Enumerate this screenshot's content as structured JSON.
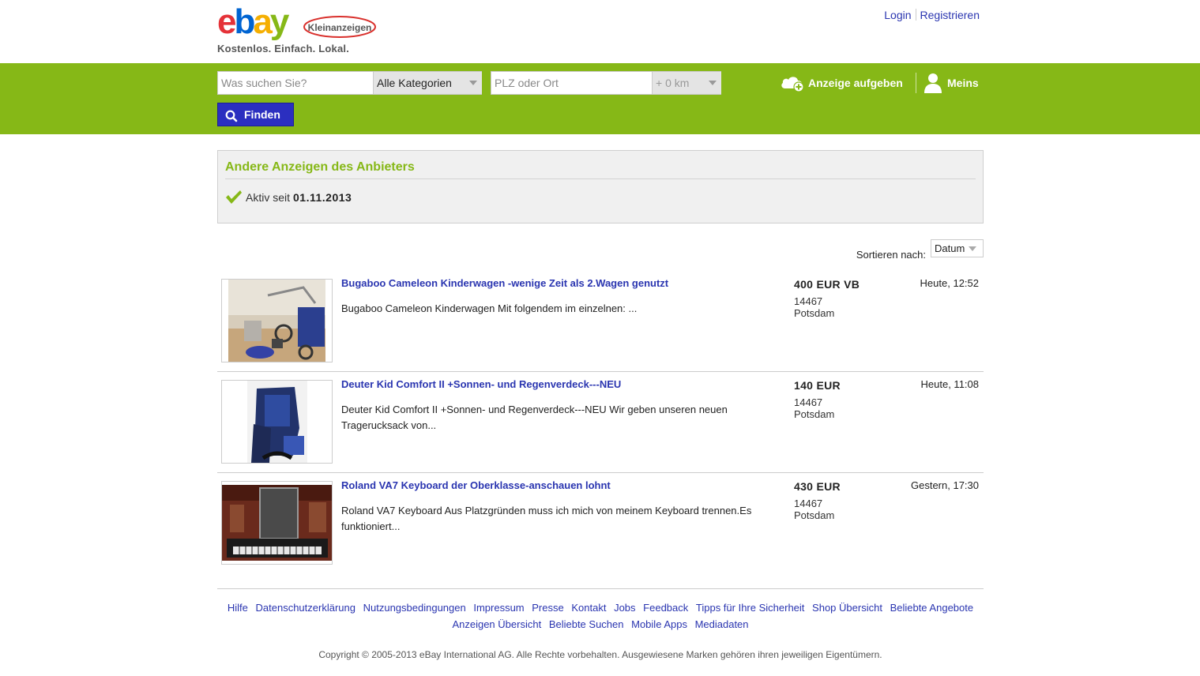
{
  "header": {
    "logo_text": "ebay",
    "logo_badge": "Kleinanzeigen",
    "tagline": "Kostenlos. Einfach. Lokal.",
    "login": "Login",
    "register": "Registrieren"
  },
  "search": {
    "query_placeholder": "Was suchen Sie?",
    "category": "Alle Kategorien",
    "location_placeholder": "PLZ oder Ort",
    "radius": "+ 0 km",
    "find_label": "Finden",
    "post_ad_label": "Anzeige aufgeben",
    "meins_label": "Meins"
  },
  "seller": {
    "title": "Andere Anzeigen des Anbieters",
    "active_prefix": "Aktiv seit",
    "active_date": "01.11.2013"
  },
  "sort": {
    "label": "Sortieren nach:",
    "value": "Datum"
  },
  "listings": [
    {
      "title": "Bugaboo Cameleon Kinderwagen -wenige Zeit als 2.Wagen genutzt",
      "description": "Bugaboo Cameleon Kinderwagen Mit folgendem im einzelnen: ...",
      "price": "400 EUR VB",
      "zip": "14467",
      "city": "Potsdam",
      "date": "Heute, 12:52"
    },
    {
      "title": "Deuter Kid Comfort II +Sonnen- und Regenverdeck---NEU",
      "description": "Deuter Kid Comfort II +Sonnen- und Regenverdeck---NEU Wir geben unseren neuen Tragerucksack von...",
      "price": "140 EUR",
      "zip": "14467",
      "city": "Potsdam",
      "date": "Heute, 11:08"
    },
    {
      "title": "Roland VA7 Keyboard der Oberklasse-anschauen lohnt",
      "description": "Roland VA7 Keyboard Aus Platzgründen muss ich mich von meinem Keyboard trennen.Es funktioniert...",
      "price": "430 EUR",
      "zip": "14467",
      "city": "Potsdam",
      "date": "Gestern, 17:30"
    }
  ],
  "footer": {
    "links": [
      "Hilfe",
      "Datenschutzerklärung",
      "Nutzungsbedingungen",
      "Impressum",
      "Presse",
      "Kontakt",
      "Jobs",
      "Feedback",
      "Tipps für Ihre Sicherheit",
      "Shop Übersicht",
      "Beliebte Angebote",
      "Anzeigen Übersicht",
      "Beliebte Suchen",
      "Mobile Apps",
      "Mediadaten"
    ],
    "copyright": "Copyright © 2005-2013 eBay International AG. Alle Rechte vorbehalten. Ausgewiesene Marken gehören ihren jeweiligen Eigentümern."
  },
  "colors": {
    "brand_green": "#86b817",
    "link_blue": "#2a35b0",
    "button_blue": "#2b2fc0"
  }
}
